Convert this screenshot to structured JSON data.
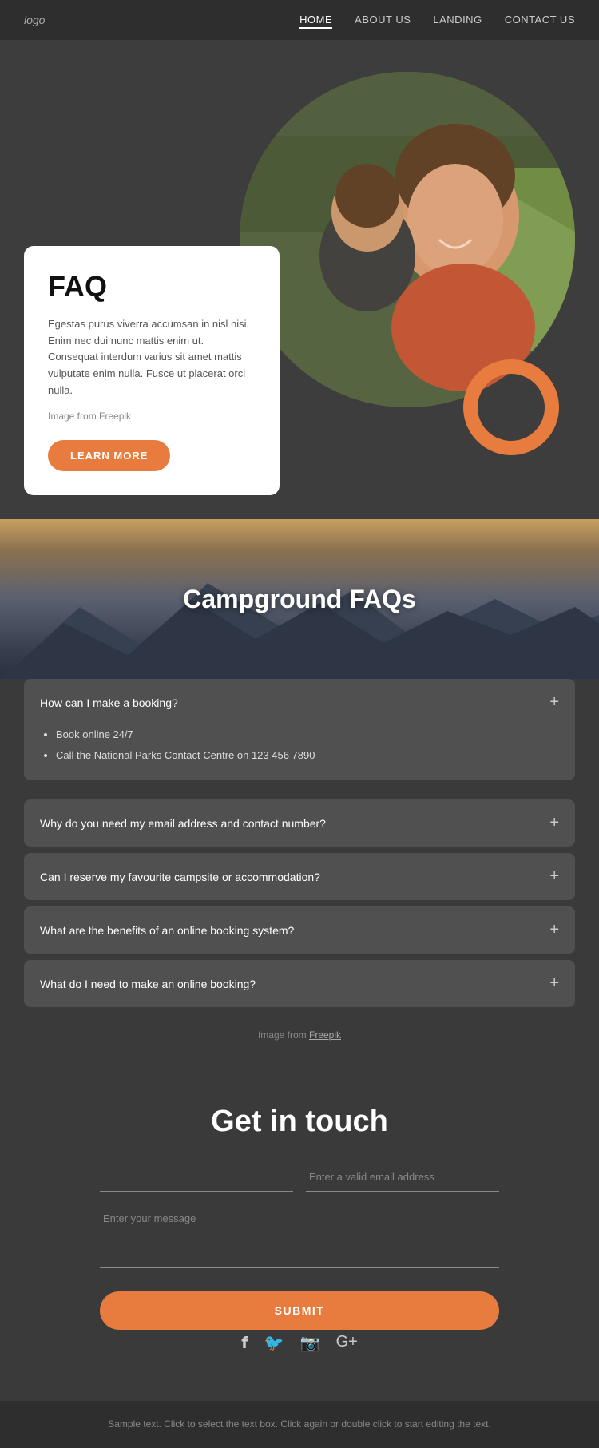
{
  "nav": {
    "logo": "logo",
    "links": [
      {
        "label": "HOME",
        "active": true
      },
      {
        "label": "ABOUT US",
        "active": false
      },
      {
        "label": "LANDING",
        "active": false
      },
      {
        "label": "CONTACT US",
        "active": false
      }
    ]
  },
  "hero": {
    "faq_title": "FAQ",
    "faq_description": "Egestas purus viverra accumsan in nisl nisi. Enim nec dui nunc mattis enim ut. Consequat interdum varius sit amet mattis vulputate enim nulla. Fusce ut placerat orci nulla.",
    "image_credit": "Image from Freepik",
    "learn_more_label": "LEARN MORE"
  },
  "campground": {
    "title": "Campground FAQs",
    "accordions": [
      {
        "question": "How can I make a booking?",
        "open": true,
        "answer_items": [
          "Book online 24/7",
          "Call the National Parks Contact Centre on 123 456 7890"
        ]
      },
      {
        "question": "Why do you need my email address and contact number?",
        "open": false
      },
      {
        "question": "Can I reserve my favourite campsite or accommodation?",
        "open": false
      },
      {
        "question": "What are the benefits of an online booking system?",
        "open": false
      },
      {
        "question": "What do I need to make an online booking?",
        "open": false
      }
    ],
    "image_credit": "Image from ",
    "image_credit_link": "Freepik"
  },
  "contact": {
    "title": "Get in touch",
    "name_placeholder": "",
    "email_placeholder": "Enter a valid email address",
    "message_placeholder": "Enter your message",
    "submit_label": "SUBMIT"
  },
  "social": {
    "icons": [
      "f",
      "t",
      "ig",
      "g+"
    ]
  },
  "footer": {
    "text": "Sample text. Click to select the text box. Click again or double click to start editing the text."
  }
}
